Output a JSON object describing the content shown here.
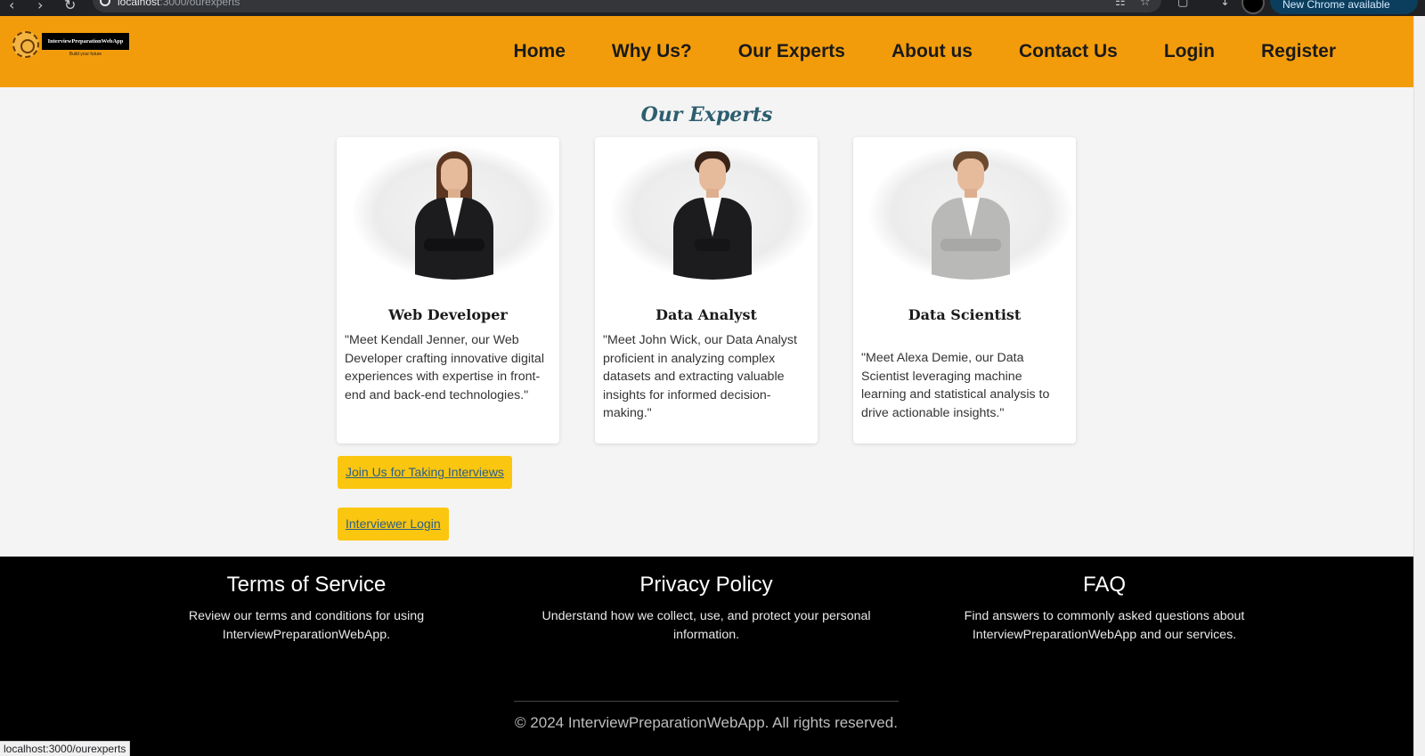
{
  "browser": {
    "url_host": "localhost",
    "url_path": ":3000/ourexperts",
    "update_label": "New Chrome available"
  },
  "header": {
    "logo_text": "InterviewPreparationWebApp",
    "logo_tagline": "Build your future",
    "nav": [
      "Home",
      "Why Us?",
      "Our Experts",
      "About us",
      "Contact Us",
      "Login",
      "Register"
    ]
  },
  "main": {
    "title": "Our Experts",
    "experts": [
      {
        "role": "Web Developer",
        "description": "\"Meet Kendall Jenner, our Web Developer crafting innovative digital experiences with expertise in front-end and back-end technologies.\""
      },
      {
        "role": "Data Analyst",
        "description": "\"Meet John Wick, our Data Analyst proficient in analyzing complex datasets and extracting valuable insights for informed decision-making.\""
      },
      {
        "role": "Data Scientist",
        "description": "\"Meet Alexa Demie, our Data Scientist leveraging machine learning and statistical analysis to drive actionable insights.\""
      }
    ],
    "join_button": "Join Us for Taking Interviews",
    "login_button": "Interviewer Login"
  },
  "footer": {
    "columns": [
      {
        "title": "Terms of Service",
        "text": "Review our terms and conditions for using InterviewPreparationWebApp."
      },
      {
        "title": "Privacy Policy",
        "text": "Understand how we collect, use, and protect your personal information."
      },
      {
        "title": "FAQ",
        "text": "Find answers to commonly asked questions about InterviewPreparationWebApp and our services."
      }
    ],
    "copyright": "© 2024 InterviewPreparationWebApp. All rights reserved."
  },
  "status_bar": {
    "url": "localhost:3000/ourexperts"
  },
  "colors": {
    "header_bg": "#f39c0b",
    "button_bg": "#fbc60f",
    "title_color": "#2c5e6e",
    "footer_bg": "#000000",
    "suit_dark": "#1c1c1e",
    "suit_gray": "#b9b9b7"
  }
}
